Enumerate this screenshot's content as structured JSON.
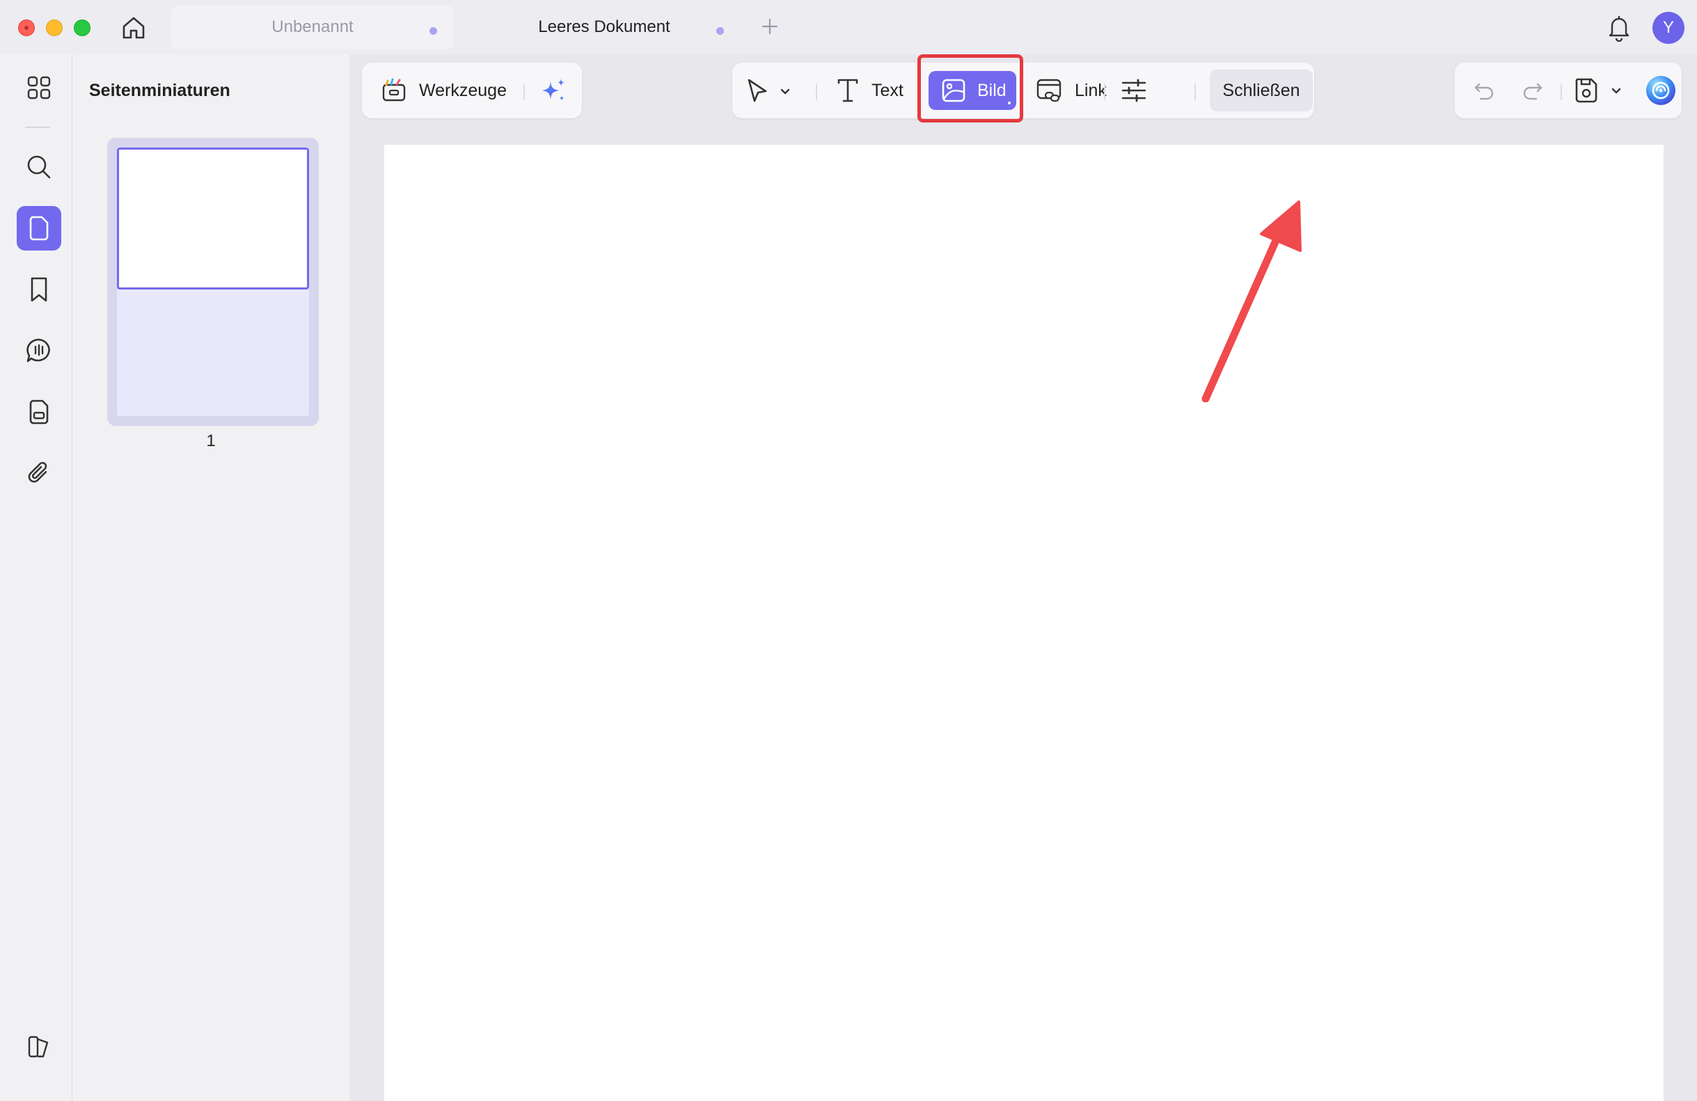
{
  "window": {
    "tabs": [
      {
        "label": "Unbenannt",
        "active": false
      },
      {
        "label": "Leeres Dokument",
        "active": true
      }
    ],
    "new_tab_symbol": "+",
    "avatar_initial": "Y",
    "icons": [
      "home-icon",
      "plus-icon",
      "bell-icon"
    ]
  },
  "left_rail": {
    "items": [
      {
        "name": "grid-view",
        "icon": "grid-icon"
      },
      {
        "name": "search",
        "icon": "search-icon"
      },
      {
        "name": "page-thumbnails",
        "icon": "page-icon",
        "active": true
      },
      {
        "name": "bookmarks",
        "icon": "bookmark-icon"
      },
      {
        "name": "comments",
        "icon": "comment-icon"
      },
      {
        "name": "forms",
        "icon": "form-icon"
      },
      {
        "name": "attachments",
        "icon": "paperclip-icon"
      }
    ],
    "bottom_icon": "sidebar-toggle-icon"
  },
  "thumbnails_panel": {
    "title": "Seitenminiaturen",
    "pages": [
      {
        "number": "1",
        "selected": true
      }
    ]
  },
  "toolbar": {
    "tools_label": "Werkzeuge",
    "text_label": "Text",
    "image_label": "Bild",
    "link_label": "Link",
    "close_label": "Schließen",
    "active_tool": "Bild"
  },
  "annotation": {
    "highlight_color": "#e5393f",
    "arrow_color": "#f04a4d",
    "target": "Bild"
  },
  "colors": {
    "accent": "#7369ee",
    "page_background": "#ffffff",
    "workspace_background": "#e7e7ec"
  }
}
